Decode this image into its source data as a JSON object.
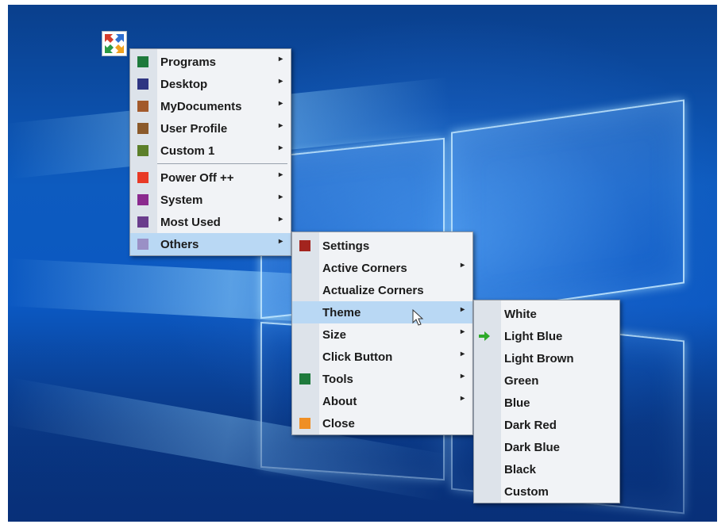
{
  "main_menu": {
    "items": [
      {
        "label": "Programs",
        "color": "#1e7a3c",
        "submenu": true
      },
      {
        "label": "Desktop",
        "color": "#2e3582",
        "submenu": true
      },
      {
        "label": "MyDocuments",
        "color": "#a25a2c",
        "submenu": true
      },
      {
        "label": "User Profile",
        "color": "#8b5a2b",
        "submenu": true
      },
      {
        "label": "Custom 1",
        "color": "#5b7f2a",
        "submenu": true
      },
      {
        "label": "Power Off ++",
        "color": "#e83a26",
        "submenu": true
      },
      {
        "label": "System",
        "color": "#8a2a8e",
        "submenu": true
      },
      {
        "label": "Most Used",
        "color": "#6a3d8c",
        "submenu": true
      },
      {
        "label": "Others",
        "color": "#9a90c6",
        "submenu": true,
        "selected": true
      }
    ],
    "submenu_glyph": "▸"
  },
  "others_menu": {
    "items": [
      {
        "label": "Settings",
        "color": "#a3241e",
        "submenu": false
      },
      {
        "label": "Active Corners",
        "color": "",
        "submenu": true
      },
      {
        "label": "Actualize Corners",
        "color": "",
        "submenu": false
      },
      {
        "label": "Theme",
        "color": "",
        "submenu": true,
        "selected": true
      },
      {
        "label": "Size",
        "color": "",
        "submenu": true
      },
      {
        "label": "Click Button",
        "color": "",
        "submenu": true
      },
      {
        "label": "Tools",
        "color": "#1e7a3c",
        "submenu": true
      },
      {
        "label": "About",
        "color": "",
        "submenu": true
      },
      {
        "label": "Close",
        "color": "#ef8f24",
        "submenu": false
      }
    ]
  },
  "theme_menu": {
    "items": [
      {
        "label": "White"
      },
      {
        "label": "Light Blue",
        "checked": true
      },
      {
        "label": "Light Brown"
      },
      {
        "label": "Green"
      },
      {
        "label": "Blue"
      },
      {
        "label": "Dark Red"
      },
      {
        "label": "Dark Blue"
      },
      {
        "label": "Black"
      },
      {
        "label": "Custom"
      }
    ],
    "check_icon": "green-arrow-icon",
    "check_color": "#2eaa2a"
  },
  "app_icon": {
    "name": "corners-app-icon",
    "colors": [
      "#d63c2c",
      "#2f6fd1",
      "#2b9a44",
      "#f0a21e"
    ]
  },
  "colors": {
    "selection": "#b9d8f4",
    "menu_bg": "#f1f3f6",
    "gutter": "#dde3ea"
  }
}
